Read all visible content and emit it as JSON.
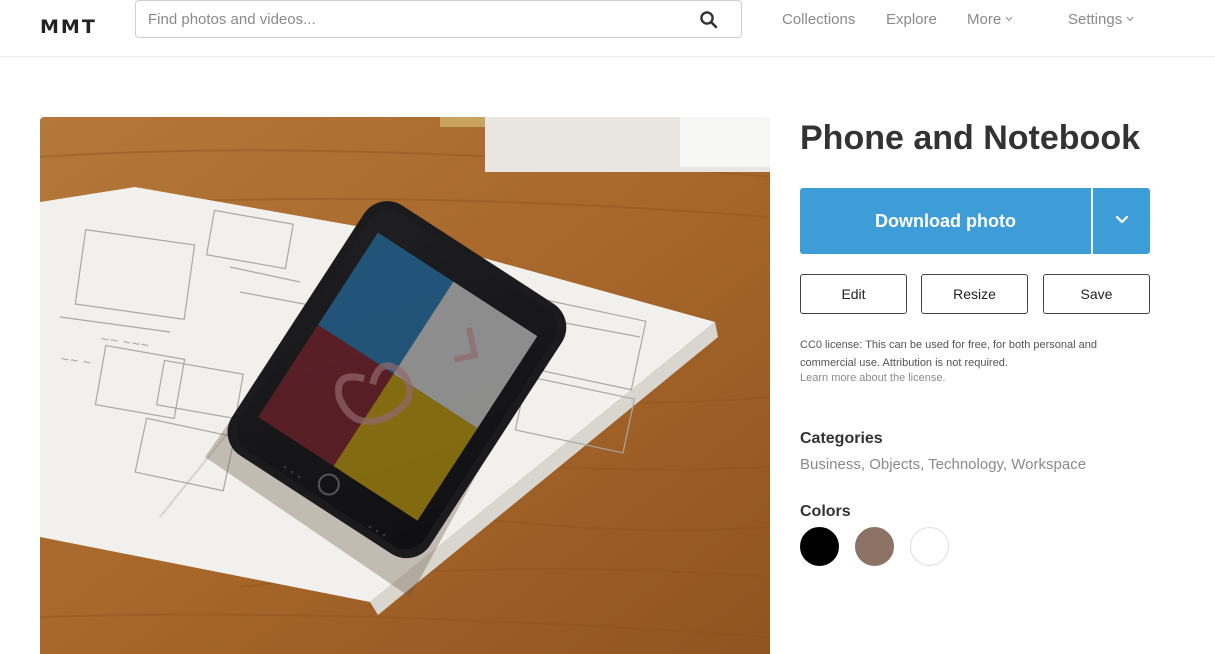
{
  "header": {
    "logo": "MMT",
    "search": {
      "placeholder": "Find photos and videos...",
      "value": ""
    },
    "nav": {
      "collections": "Collections",
      "explore": "Explore",
      "more": "More",
      "settings": "Settings"
    }
  },
  "photo": {
    "description_icon": "phone-on-notebook-image"
  },
  "sidebar": {
    "title": "Phone and Notebook",
    "download": {
      "label": "Download photo",
      "color": "#3e9dd6"
    },
    "actions": {
      "edit": "Edit",
      "resize": "Resize",
      "save": "Save"
    },
    "license": {
      "text": "CC0 license: This can be used for free, for both personal and commercial use. Attribution is not required.",
      "link": "Learn more about the license."
    },
    "categories": {
      "heading": "Categories",
      "items": [
        "Business",
        "Objects",
        "Technology",
        "Workspace"
      ],
      "sep1": ", ",
      "sep2": ", ",
      "sep3": ", "
    },
    "colors": {
      "heading": "Colors",
      "swatches": [
        "#000000",
        "#8b7265",
        "#ffffff"
      ]
    }
  }
}
